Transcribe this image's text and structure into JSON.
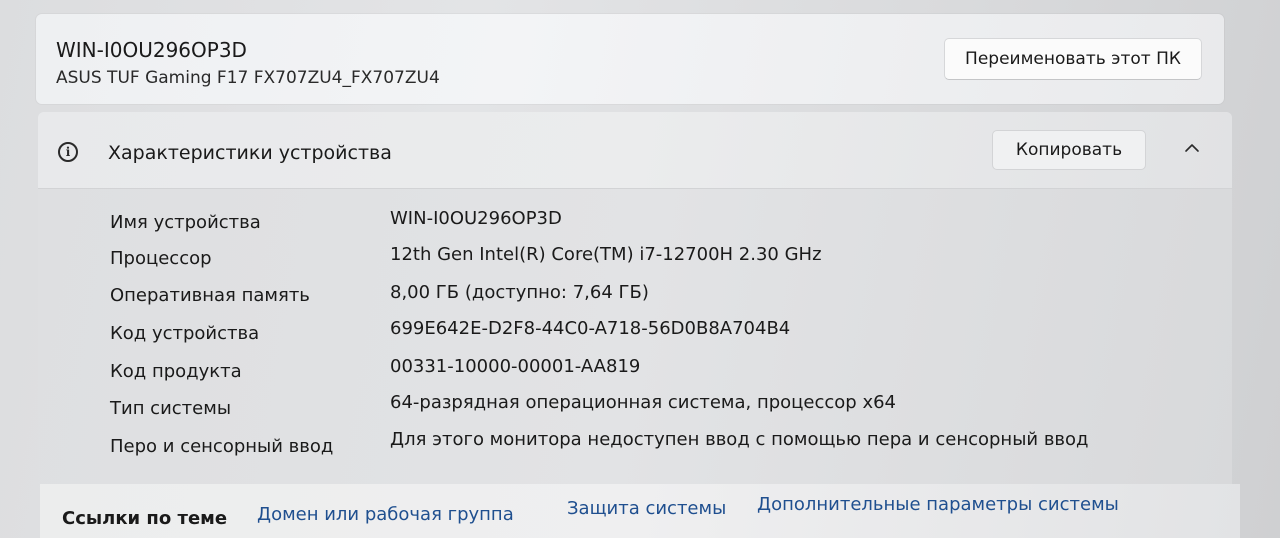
{
  "device": {
    "name": "WIN-I0OU296OP3D",
    "model": "ASUS TUF Gaming F17 FX707ZU4_FX707ZU4",
    "rename_label": "Переименовать этот ПК"
  },
  "specs": {
    "title": "Характеристики устройства",
    "copy_label": "Копировать",
    "info_icon": "i",
    "rows": [
      {
        "label": "Имя устройства",
        "value": "WIN-I0OU296OP3D"
      },
      {
        "label": "Процессор",
        "value": "12th Gen Intel(R) Core(TM) i7-12700H   2.30 GHz"
      },
      {
        "label": "Оперативная память",
        "value": "8,00 ГБ (доступно: 7,64 ГБ)"
      },
      {
        "label": "Код устройства",
        "value": "699E642E-D2F8-44C0-A718-56D0B8A704B4"
      },
      {
        "label": "Код продукта",
        "value": "00331-10000-00001-AA819"
      },
      {
        "label": "Тип системы",
        "value": "64-разрядная операционная система, процессор x64"
      },
      {
        "label": "Перо и сенсорный ввод",
        "value": "Для этого монитора недоступен ввод с помощью пера и сенсорный ввод"
      }
    ]
  },
  "related": {
    "title": "Ссылки по теме",
    "links": [
      "Домен или рабочая группа",
      "Защита системы",
      "Дополнительные параметры системы"
    ]
  },
  "colors": {
    "link": "#1f4f8f",
    "card": "#eef0f2",
    "text": "#1a1a1a"
  }
}
